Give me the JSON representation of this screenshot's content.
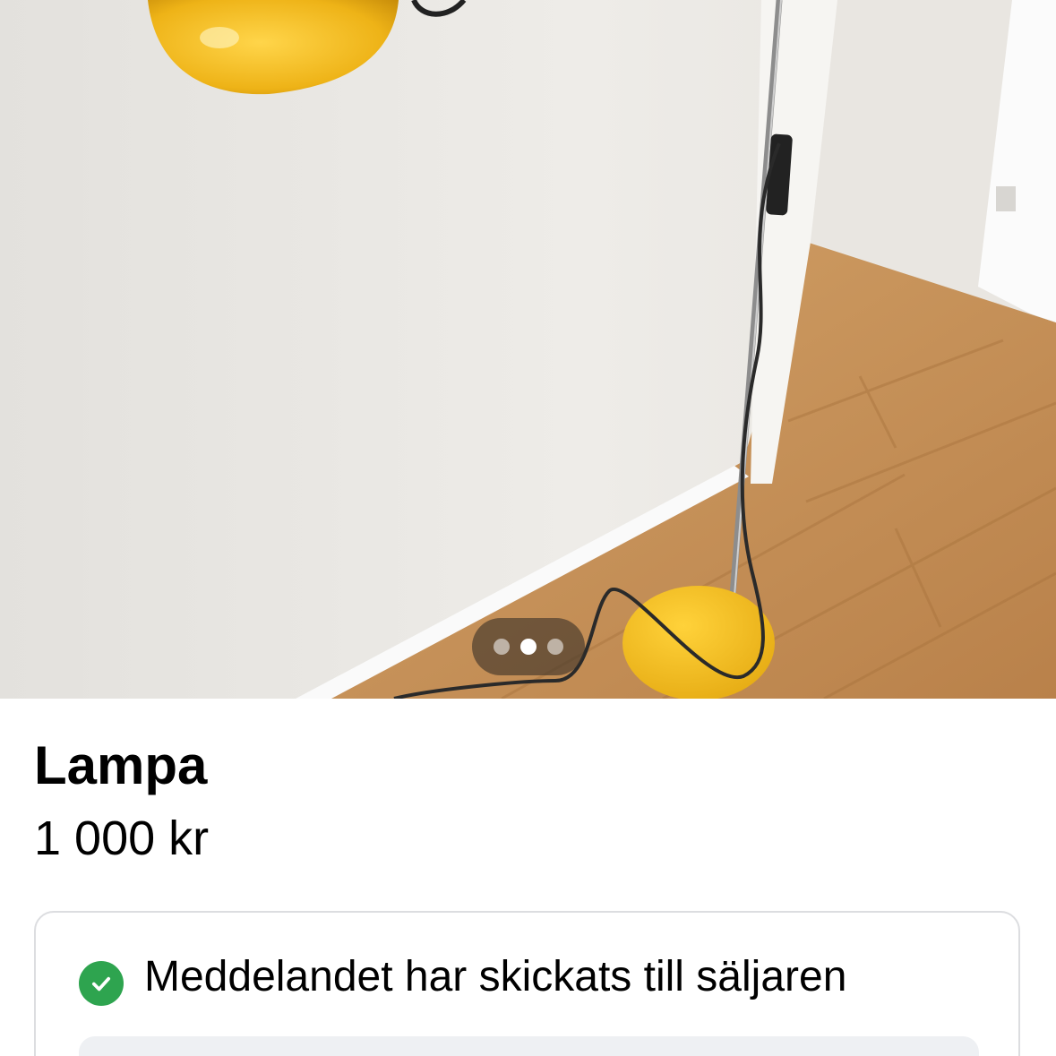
{
  "listing": {
    "title": "Lampa",
    "price": "1 000 kr"
  },
  "carousel": {
    "dot_count": 3,
    "active_index": 1
  },
  "confirmation": {
    "icon": "check-circle-icon",
    "text": "Meddelandet har skickats till säljaren",
    "icon_color": "#2ea44f"
  },
  "colors": {
    "lamp_yellow": "#f1b81a",
    "floor_wood": "#c9925a",
    "wall": "#eceae6"
  }
}
